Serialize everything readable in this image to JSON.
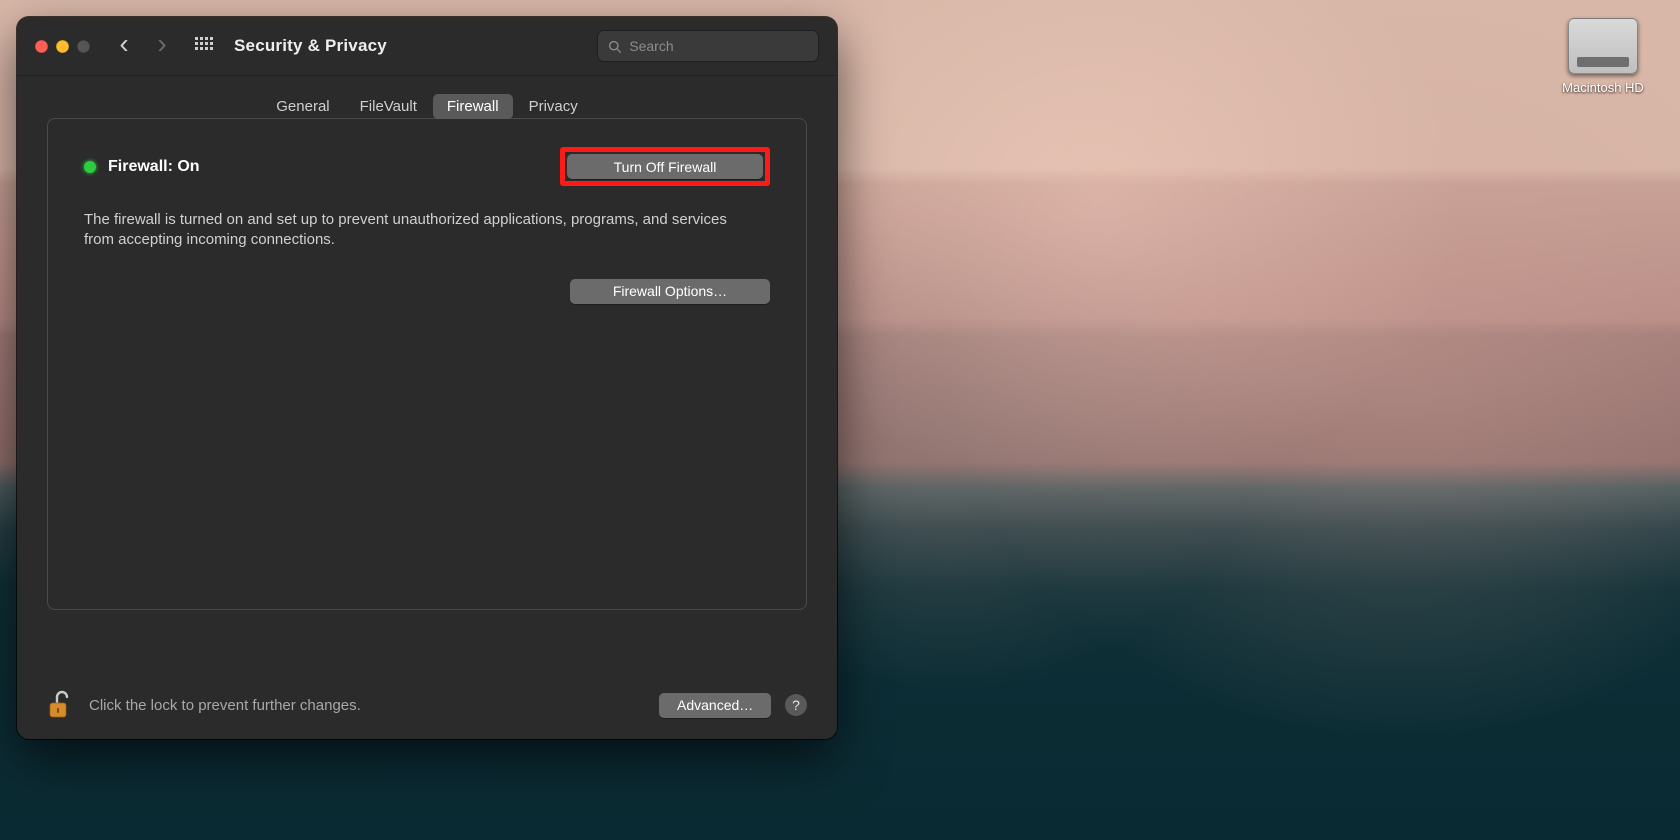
{
  "desktop": {
    "disk_label": "Macintosh HD"
  },
  "window": {
    "title": "Security & Privacy",
    "search_placeholder": "Search"
  },
  "tabs": {
    "general": "General",
    "filevault": "FileVault",
    "firewall": "Firewall",
    "privacy": "Privacy",
    "active": "firewall"
  },
  "firewall": {
    "status_label": "Firewall: On",
    "status_color": "#2ecc40",
    "toggle_button": "Turn Off Firewall",
    "description": "The firewall is turned on and set up to prevent unauthorized applications, programs, and services from accepting incoming connections.",
    "options_button": "Firewall Options…"
  },
  "footer": {
    "lock_text": "Click the lock to prevent further changes.",
    "advanced_button": "Advanced…",
    "help_label": "?"
  },
  "icons": {
    "back": "‹",
    "forward": "›"
  }
}
